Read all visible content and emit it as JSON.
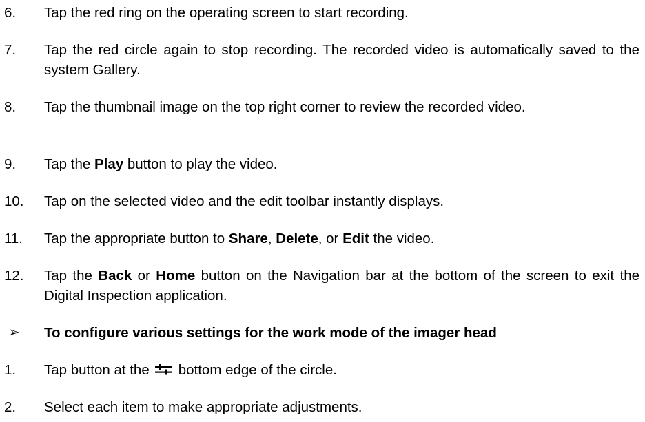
{
  "steps_a": [
    {
      "num": "6.",
      "text": "Tap the red ring on the operating screen to start recording."
    },
    {
      "num": "7.",
      "text": "Tap the red circle again to stop recording. The recorded video is automatically saved to the system Gallery."
    },
    {
      "num": "8.",
      "text": "Tap the thumbnail image on the top right corner to review the recorded video."
    },
    {
      "num": "9.",
      "pre": "Tap the ",
      "bold": "Play",
      "post": " button to play the video."
    },
    {
      "num": "10.",
      "text": "Tap on the selected video and the edit toolbar instantly displays."
    },
    {
      "num": "11.",
      "pre": "Tap the appropriate button to ",
      "b1": "Share",
      "sep1": ", ",
      "b2": "Delete",
      "sep2": ", or ",
      "b3": "Edit",
      "post": " the video."
    },
    {
      "num": "12.",
      "pre": "Tap the ",
      "b1": "Back",
      "mid": " or ",
      "b2": "Home",
      "post": " button on the Navigation bar at the bottom of the screen to exit the Digital Inspection application."
    }
  ],
  "section": {
    "bullet": "➢",
    "title": "To configure various settings for the work mode of the imager head"
  },
  "steps_b": [
    {
      "num": "1.",
      "pre": "Tap button at the",
      "icon": "settings-sliders-icon",
      "post": "bottom edge of the circle."
    },
    {
      "num": "2.",
      "text": "Select each item to make appropriate adjustments."
    }
  ]
}
